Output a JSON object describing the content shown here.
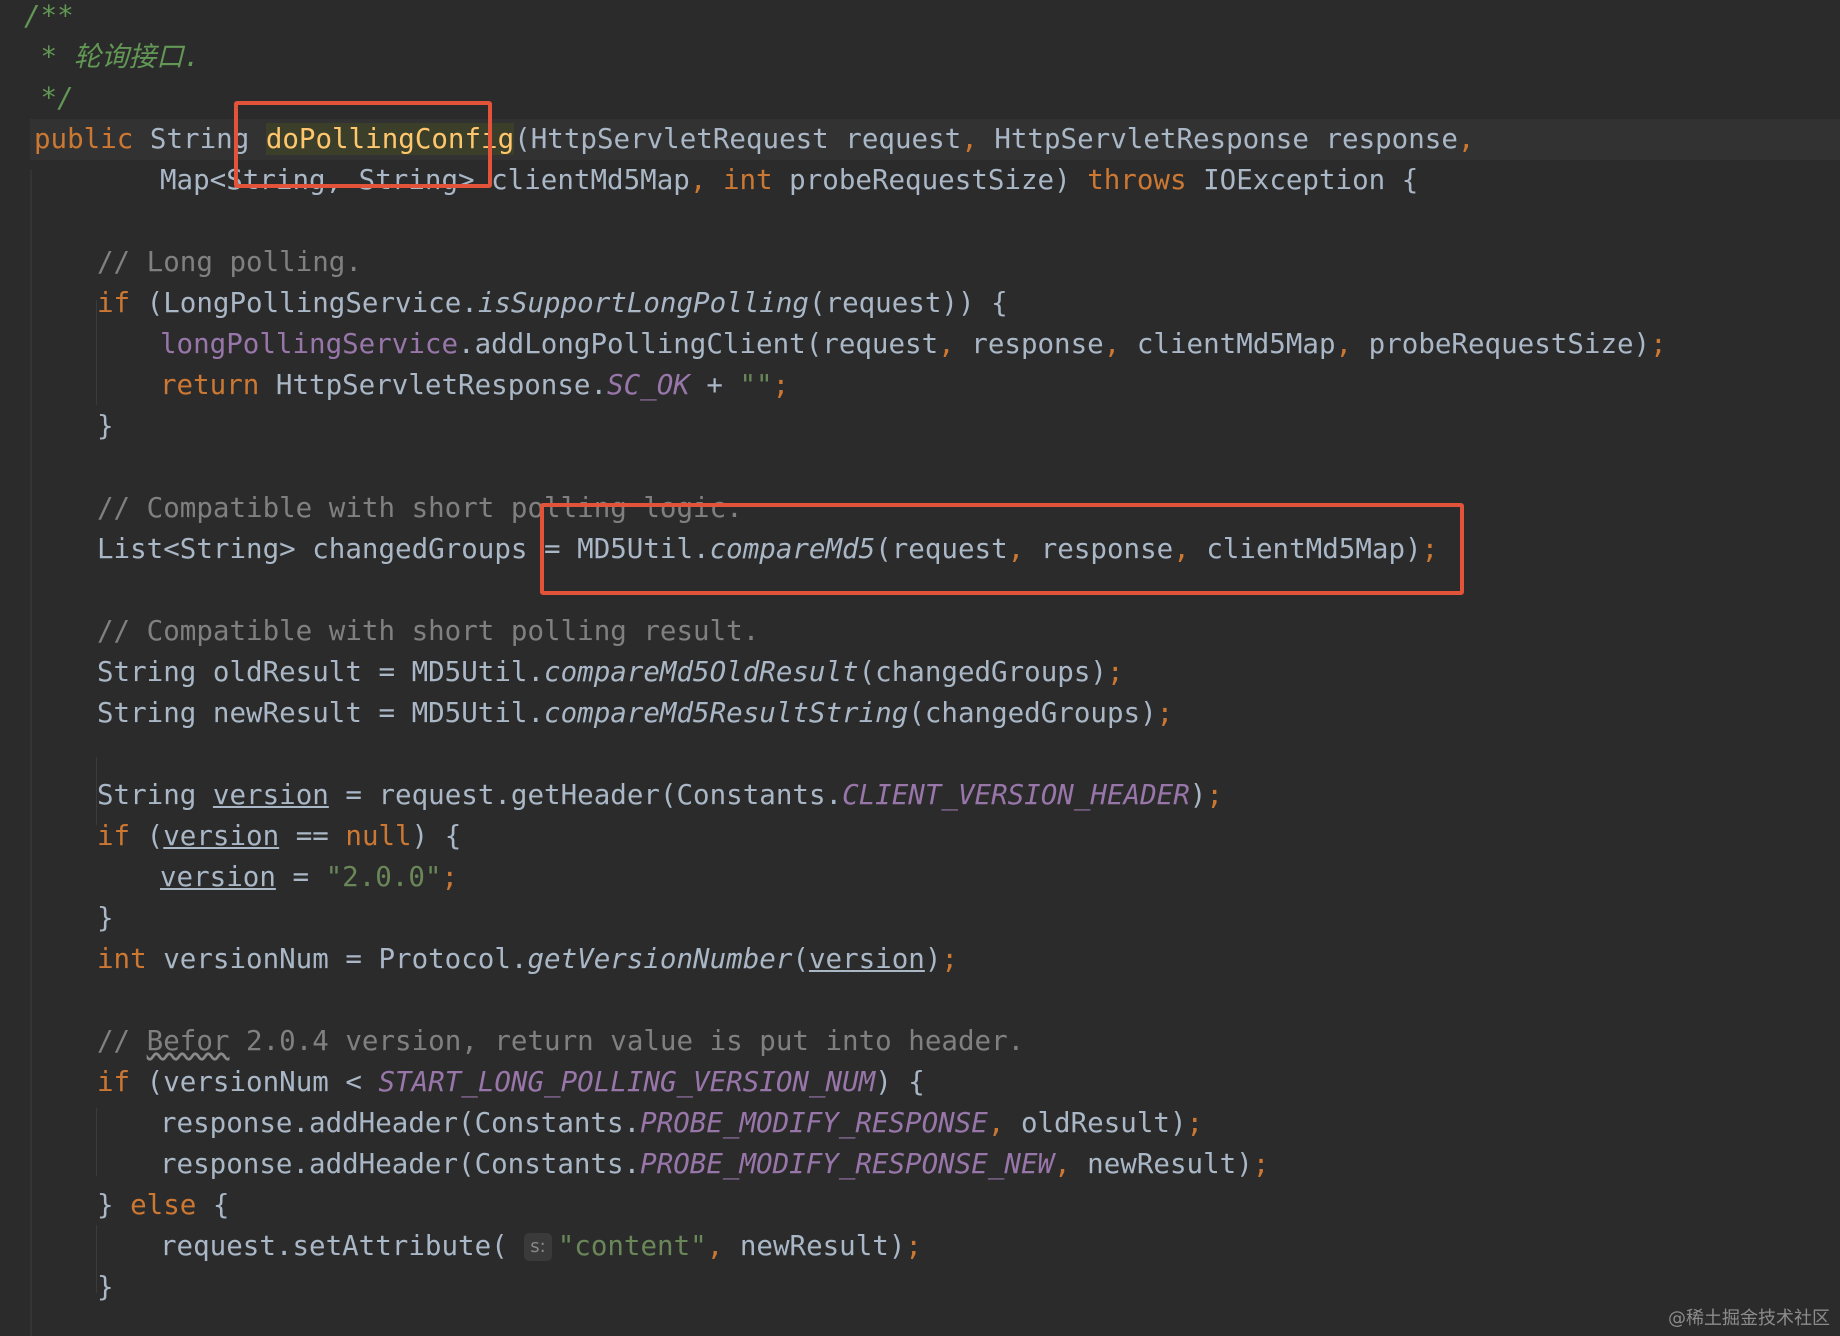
{
  "code": {
    "doc_open": "/**",
    "doc_line": " * 轮询接口.",
    "doc_close": " */",
    "sig": {
      "public": "public",
      "string_type": "String",
      "method_name": "doPollingConfig",
      "params_a": "(HttpServletRequest request",
      "comma": ",",
      "params_b": " HttpServletResponse response",
      "map_type": "Map<String, String> clientMd5Map",
      "int_kw": "int",
      "probe": " probeRequestSize)",
      "throws_kw": "throws",
      "exception": " IOException {"
    },
    "comment_long_polling": "// Long polling.",
    "if_kw": "if",
    "if_support_a": " (LongPollingService.",
    "if_support_method": "isSupportLongPolling",
    "if_support_b": "(request)) {",
    "lps_field": "longPollingService",
    "lps_call": ".addLongPollingClient(request",
    "lps_args": " response",
    "lps_args2": " clientMd5Map",
    "lps_args3": " probeRequestSize)",
    "semicolon": ";",
    "return_kw": "return",
    "return_a": " HttpServletResponse.",
    "sc_ok": "SC_OK",
    "return_b": " + ",
    "empty_str": "\"\"",
    "close_brace": "}",
    "comment_short_logic": "// Compatible with short polling logic.",
    "changed_a": "List<String> changedGroups = MD5Util.",
    "compare_md5": "compareMd5",
    "changed_b": "(request",
    "changed_c": " response",
    "changed_d": " clientMd5Map)",
    "comment_short_result": "// Compatible with short polling result.",
    "old_a": "String oldResult = MD5Util.",
    "old_method": "compareMd5OldResult",
    "old_b": "(changedGroups)",
    "new_a": "String newResult = MD5Util.",
    "new_method": "compareMd5ResultString",
    "new_b": "(changedGroups)",
    "string_kw": "String ",
    "version_var": "version",
    "ver_a": " = request.getHeader(Constants.",
    "client_version_header": "CLIENT_VERSION_HEADER",
    "close_paren": ")",
    "if_version_a": " (",
    "eqnull": " == ",
    "null_kw": "null",
    "if_version_b": ") {",
    "assign": " = ",
    "version_str": "\"2.0.0\"",
    "int_kw": "int",
    "vnum_a": " versionNum = Protocol.",
    "get_version_number": "getVersionNumber",
    "open_paren": "(",
    "comment_befor_a": "// ",
    "befor_word": "Befor",
    "comment_befor_b": " 2.0.4 version, return value is put into header.",
    "if_vnum_a": " (versionNum < ",
    "start_long_polling": "START_LONG_POLLING_VERSION_NUM",
    "if_vnum_b": ") {",
    "add_header_a": "response.addHeader(Constants.",
    "probe_modify_response": "PROBE_MODIFY_RESPONSE",
    "old_result_arg": " oldResult)",
    "probe_modify_response_new": "PROBE_MODIFY_RESPONSE_NEW",
    "new_result_arg": " newResult)",
    "else_a": "} ",
    "else_kw": "else",
    "else_b": " {",
    "set_attr_a": "request.setAttribute( ",
    "param_hint": "s:",
    "content_str": "\"content\"",
    "set_attr_b": " newResult)"
  },
  "watermark": "@稀土掘金技术社区",
  "colors": {
    "background": "#2b2b2b",
    "keyword": "#cc7832",
    "comment": "#808080",
    "doc_comment": "#629755",
    "method_decl": "#ffc66d",
    "string": "#6a8759",
    "constant": "#9876aa",
    "plain": "#a9b7c6",
    "annotation_box": "#e2533a"
  }
}
